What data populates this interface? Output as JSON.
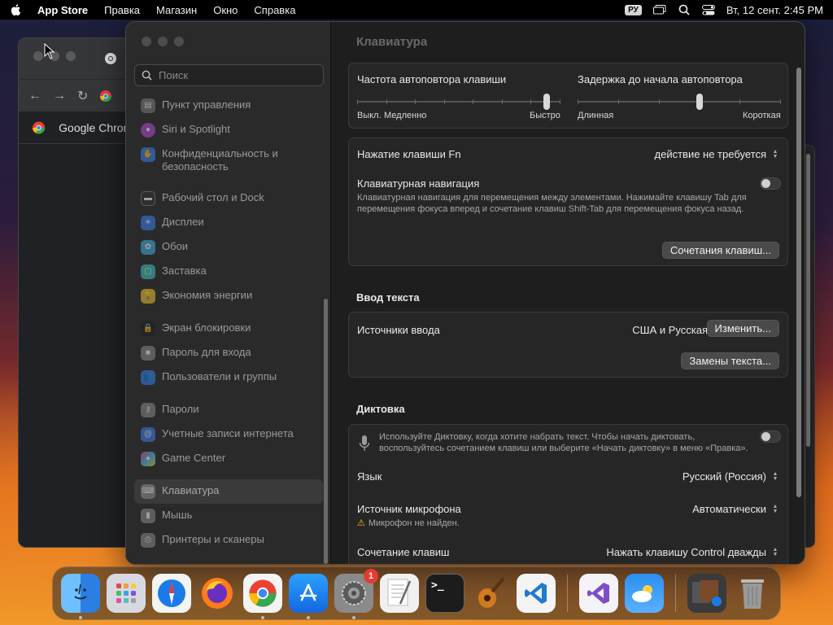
{
  "menubar": {
    "app_name": "App Store",
    "items": [
      "Правка",
      "Магазин",
      "Окно",
      "Справка"
    ],
    "lang": "РУ",
    "datetime": "Вт, 12 сент.  2:45 PM"
  },
  "chrome": {
    "bookmark": "Google Chrome"
  },
  "sidebar": {
    "search_placeholder": "Поиск",
    "items": [
      {
        "label": "Пункт управления",
        "icon": "control-center-icon",
        "color": "#7a7a7a"
      },
      {
        "label": "Siri и Spotlight",
        "icon": "siri-icon",
        "color": "#b04fd0"
      },
      {
        "label": "Конфиденциальность и безопасность",
        "icon": "privacy-hand-icon",
        "color": "#3a7ff0"
      },
      {
        "label": "Рабочий стол и Dock",
        "icon": "desktop-dock-icon",
        "color": "#333"
      },
      {
        "label": "Дисплеи",
        "icon": "display-icon",
        "color": "#3a7ff0"
      },
      {
        "label": "Обои",
        "icon": "wallpaper-icon",
        "color": "#40b0e0"
      },
      {
        "label": "Заставка",
        "icon": "screensaver-icon",
        "color": "#40c0c0"
      },
      {
        "label": "Экономия энергии",
        "icon": "energy-icon",
        "color": "#f0c030"
      },
      {
        "label": "Экран блокировки",
        "icon": "lock-screen-icon",
        "color": "#222"
      },
      {
        "label": "Пароль для входа",
        "icon": "login-password-icon",
        "color": "#8a8a8a"
      },
      {
        "label": "Пользователи и группы",
        "icon": "users-groups-icon",
        "color": "#3a7ff0"
      },
      {
        "label": "Пароли",
        "icon": "key-icon",
        "color": "#8a8a8a"
      },
      {
        "label": "Учетные записи интернета",
        "icon": "internet-accounts-icon",
        "color": "#3a7ff0"
      },
      {
        "label": "Game Center",
        "icon": "game-center-icon",
        "color": "#e0509a"
      },
      {
        "label": "Клавиатура",
        "icon": "keyboard-icon",
        "color": "#8a8a8a"
      },
      {
        "label": "Мышь",
        "icon": "mouse-icon",
        "color": "#8a8a8a"
      },
      {
        "label": "Принтеры и сканеры",
        "icon": "printer-icon",
        "color": "#8a8a8a"
      }
    ]
  },
  "content": {
    "title": "Клавиатура",
    "key_repeat": {
      "label": "Частота автоповтора клавиши",
      "min1": "Выкл.",
      "min2": "Медленно",
      "max": "Быстро",
      "value_fraction": 0.93
    },
    "repeat_delay": {
      "label": "Задержка до начала автоповтора",
      "min": "Длинная",
      "max": "Короткая",
      "value_fraction": 0.6
    },
    "fn_key": {
      "label": "Нажатие клавиши Fn",
      "value": "действие не требуется"
    },
    "keyboard_nav": {
      "label": "Клавиатурная навигация",
      "desc": "Клавиатурная навигация для перемещения между элементами. Нажимайте клавишу Tab для перемещения фокуса вперед и сочетание клавиш Shift-Tab для перемещения фокуса назад.",
      "enabled": false
    },
    "shortcuts_button": "Сочетания клавиш...",
    "text_input_title": "Ввод текста",
    "input_sources": {
      "label": "Источники ввода",
      "value": "США и Русская",
      "button": "Изменить..."
    },
    "text_replacements_button": "Замены текста...",
    "dictation_title": "Диктовка",
    "dictation": {
      "desc": "Используйте Диктовку, когда хотите набрать текст. Чтобы начать диктовать, воспользуйтесь сочетанием клавиш или выберите «Начать диктовку» в меню «Правка».",
      "enabled": false
    },
    "language": {
      "label": "Язык",
      "value": "Русский (Россия)"
    },
    "mic_source": {
      "label": "Источник микрофона",
      "value": "Автоматически",
      "warning": "Микрофон не найден."
    },
    "shortcut": {
      "label": "Сочетание клавиш",
      "value": "Нажать клавишу Control дважды"
    }
  },
  "dock": {
    "badge_settings": "1",
    "apps": [
      {
        "name": "finder-icon",
        "color": "#2a8ff0"
      },
      {
        "name": "launchpad-icon",
        "color": "#d8d8e0"
      },
      {
        "name": "safari-icon",
        "color": "#1a7ae8"
      },
      {
        "name": "firefox-icon",
        "color": "#6a2fbf"
      },
      {
        "name": "chrome-icon",
        "color": "#f4f4f4"
      },
      {
        "name": "app-store-icon",
        "color": "#1c8cf5"
      },
      {
        "name": "system-settings-icon",
        "color": "#8a8a8a"
      },
      {
        "name": "textedit-icon",
        "color": "#f0f0f0"
      },
      {
        "name": "terminal-icon",
        "color": "#1c1c1c"
      },
      {
        "name": "garageband-icon",
        "color": "#3a3a3a"
      },
      {
        "name": "vscode-icon",
        "color": "#1f7ad0"
      },
      {
        "name": "visual-studio-icon",
        "color": "#f4f4f8"
      },
      {
        "name": "weather-icon",
        "color": "#2a8ff0"
      },
      {
        "name": "downloads-stack-icon",
        "color": "#444"
      },
      {
        "name": "trash-icon",
        "color": "#888"
      }
    ]
  }
}
